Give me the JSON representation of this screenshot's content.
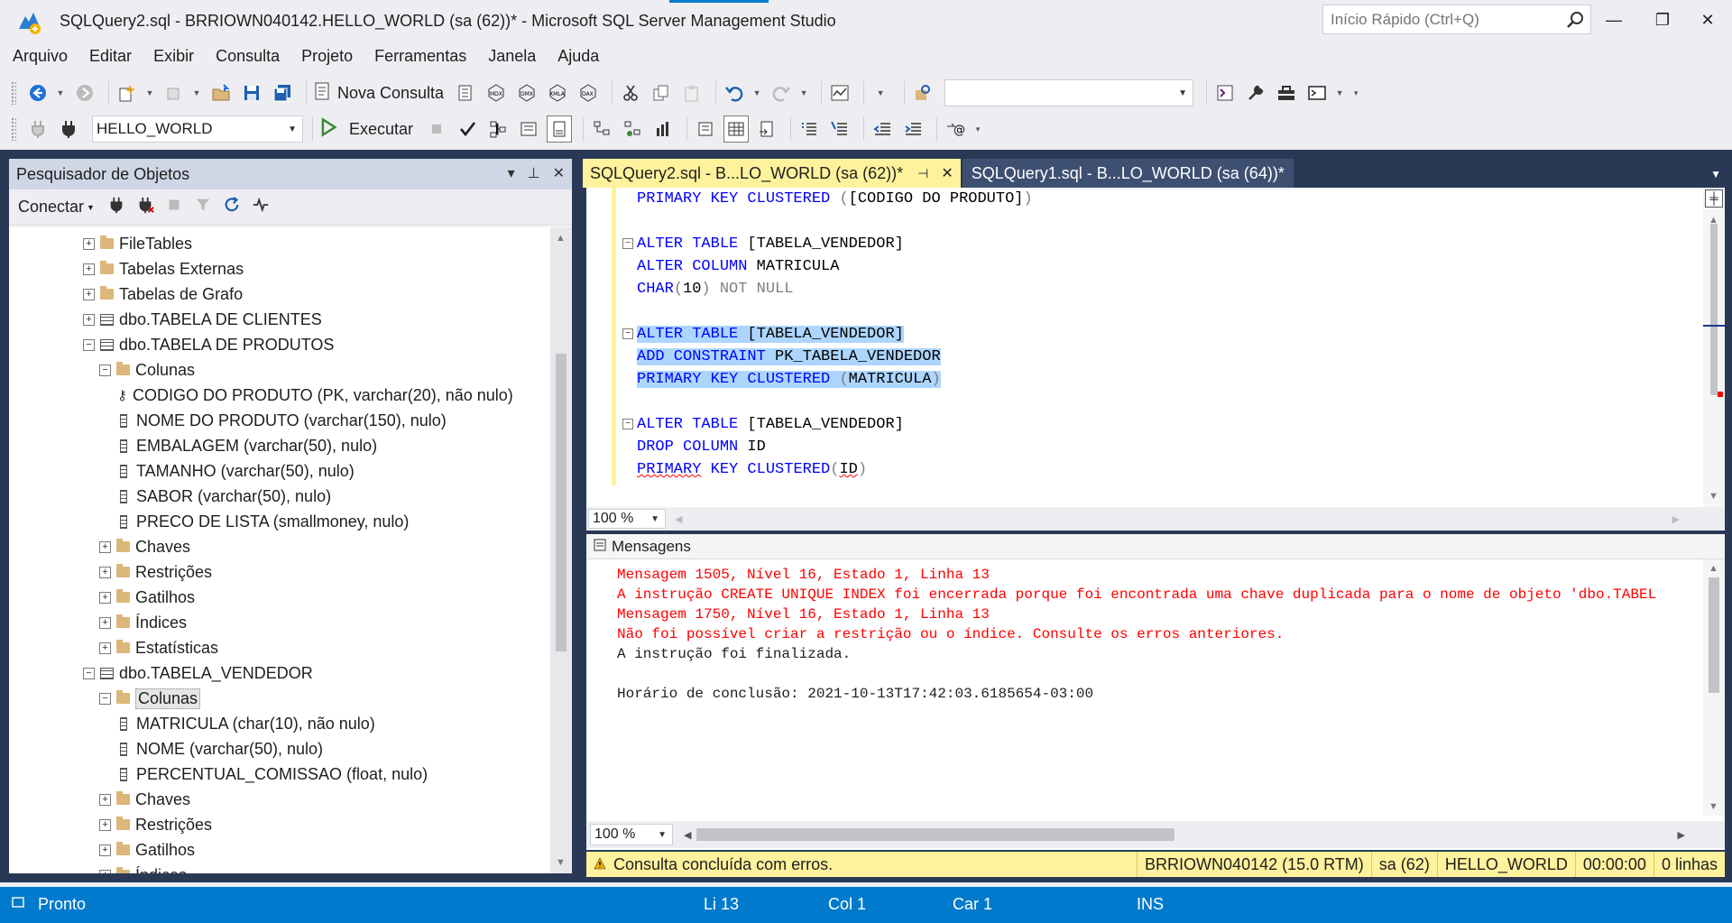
{
  "window": {
    "title": "SQLQuery2.sql - BRRIOWN040142.HELLO_WORLD (sa (62))* - Microsoft SQL Server Management Studio",
    "quick_launch_placeholder": "Início Rápido (Ctrl+Q)",
    "minimize": "—",
    "restore": "❐",
    "close": "✕"
  },
  "menu": [
    "Arquivo",
    "Editar",
    "Exibir",
    "Consulta",
    "Projeto",
    "Ferramentas",
    "Janela",
    "Ajuda"
  ],
  "toolbar1": {
    "new_query": "Nova Consulta",
    "icons": [
      "back-icon",
      "forward-icon",
      "new-project-icon",
      "add-item-icon",
      "open-file-icon",
      "save-icon",
      "save-all-icon",
      "new-query-icon",
      "mdx-icon",
      "dmx-icon",
      "xmla-icon",
      "dax-icon",
      "cut-icon",
      "copy-icon",
      "paste-icon",
      "undo-icon",
      "redo-icon",
      "activity-monitor-icon",
      "find-icon",
      "solution-explorer-icon",
      "properties-icon",
      "toolbox-icon",
      "terminal-icon"
    ]
  },
  "toolbar2": {
    "database": "HELLO_WORLD",
    "execute": "Executar"
  },
  "object_explorer": {
    "title": "Pesquisador de Objetos",
    "connect": "Conectar",
    "tree": [
      {
        "label": "FileTables",
        "type": "folder",
        "expanded": false,
        "level": 4
      },
      {
        "label": "Tabelas Externas",
        "type": "folder",
        "expanded": false,
        "level": 4
      },
      {
        "label": "Tabelas de Grafo",
        "type": "folder",
        "expanded": false,
        "level": 4
      },
      {
        "label": "dbo.TABELA DE CLIENTES",
        "type": "table",
        "expanded": false,
        "level": 4
      },
      {
        "label": "dbo.TABELA DE PRODUTOS",
        "type": "table",
        "expanded": true,
        "level": 4
      },
      {
        "label": "Colunas",
        "type": "folder",
        "expanded": true,
        "level": 5
      },
      {
        "label": "CODIGO DO PRODUTO (PK, varchar(20), não nulo)",
        "type": "key",
        "level": 6
      },
      {
        "label": "NOME DO PRODUTO (varchar(150), nulo)",
        "type": "column",
        "level": 6
      },
      {
        "label": "EMBALAGEM (varchar(50), nulo)",
        "type": "column",
        "level": 6
      },
      {
        "label": "TAMANHO (varchar(50), nulo)",
        "type": "column",
        "level": 6
      },
      {
        "label": "SABOR (varchar(50), nulo)",
        "type": "column",
        "level": 6
      },
      {
        "label": "PRECO DE LISTA (smallmoney, nulo)",
        "type": "column",
        "level": 6
      },
      {
        "label": "Chaves",
        "type": "folder",
        "expanded": false,
        "level": 5
      },
      {
        "label": "Restrições",
        "type": "folder",
        "expanded": false,
        "level": 5
      },
      {
        "label": "Gatilhos",
        "type": "folder",
        "expanded": false,
        "level": 5
      },
      {
        "label": "Índices",
        "type": "folder",
        "expanded": false,
        "level": 5
      },
      {
        "label": "Estatísticas",
        "type": "folder",
        "expanded": false,
        "level": 5
      },
      {
        "label": "dbo.TABELA_VENDEDOR",
        "type": "table",
        "expanded": true,
        "level": 4
      },
      {
        "label": "Colunas",
        "type": "folder",
        "expanded": true,
        "level": 5,
        "selected": true
      },
      {
        "label": "MATRICULA (char(10), não nulo)",
        "type": "column",
        "level": 6
      },
      {
        "label": "NOME (varchar(50), nulo)",
        "type": "column",
        "level": 6
      },
      {
        "label": "PERCENTUAL_COMISSAO (float, nulo)",
        "type": "column",
        "level": 6
      },
      {
        "label": "Chaves",
        "type": "folder",
        "expanded": false,
        "level": 5
      },
      {
        "label": "Restrições",
        "type": "folder",
        "expanded": false,
        "level": 5
      },
      {
        "label": "Gatilhos",
        "type": "folder",
        "expanded": false,
        "level": 5
      },
      {
        "label": "Índices",
        "type": "folder",
        "expanded": false,
        "level": 5
      }
    ]
  },
  "tabs": [
    {
      "label": "SQLQuery2.sql - B...LO_WORLD (sa (62))*",
      "active": true
    },
    {
      "label": "SQLQuery1.sql - B...LO_WORLD (sa (64))*",
      "active": false
    }
  ],
  "editor": {
    "zoom": "100 %",
    "lines": [
      "PRIMARY KEY CLUSTERED ([CODIGO DO PRODUTO])",
      "",
      "ALTER TABLE [TABELA_VENDEDOR]",
      "ALTER COLUMN MATRICULA",
      "CHAR(10) NOT NULL",
      "",
      "ALTER TABLE [TABELA_VENDEDOR]",
      "ADD CONSTRAINT PK_TABELA_VENDEDOR",
      "PRIMARY KEY CLUSTERED (MATRICULA)",
      "",
      "ALTER TABLE [TABELA_VENDEDOR]",
      "DROP COLUMN ID",
      "PRIMARY KEY CLUSTERED(ID)"
    ]
  },
  "results": {
    "tab": "Mensagens",
    "zoom": "100 %",
    "messages": [
      {
        "text": "Mensagem 1505, Nível 16, Estado 1, Linha 13",
        "error": true
      },
      {
        "text": "A instrução CREATE UNIQUE INDEX foi encerrada porque foi encontrada uma chave duplicada para o nome de objeto 'dbo.TABEL",
        "error": true
      },
      {
        "text": "Mensagem 1750, Nível 16, Estado 1, Linha 13",
        "error": true
      },
      {
        "text": "Não foi possível criar a restrição ou o índice. Consulte os erros anteriores.",
        "error": true
      },
      {
        "text": "A instrução foi finalizada.",
        "error": false
      },
      {
        "text": "",
        "error": false
      },
      {
        "text": "Horário de conclusão: 2021-10-13T17:42:03.6185654-03:00",
        "error": false
      }
    ]
  },
  "query_status": {
    "message": "Consulta concluída com erros.",
    "server": "BRRIOWN040142 (15.0 RTM)",
    "user": "sa (62)",
    "database": "HELLO_WORLD",
    "elapsed": "00:00:00",
    "rows": "0 linhas"
  },
  "statusbar": {
    "state": "Pronto",
    "line": "Li 13",
    "col": "Col 1",
    "char": "Car 1",
    "mode": "INS"
  },
  "colors": {
    "accent": "#007acc",
    "tab_active": "#fff29d",
    "keyword": "#0000ff",
    "error": "#ff0000",
    "selection": "#add6ff"
  }
}
